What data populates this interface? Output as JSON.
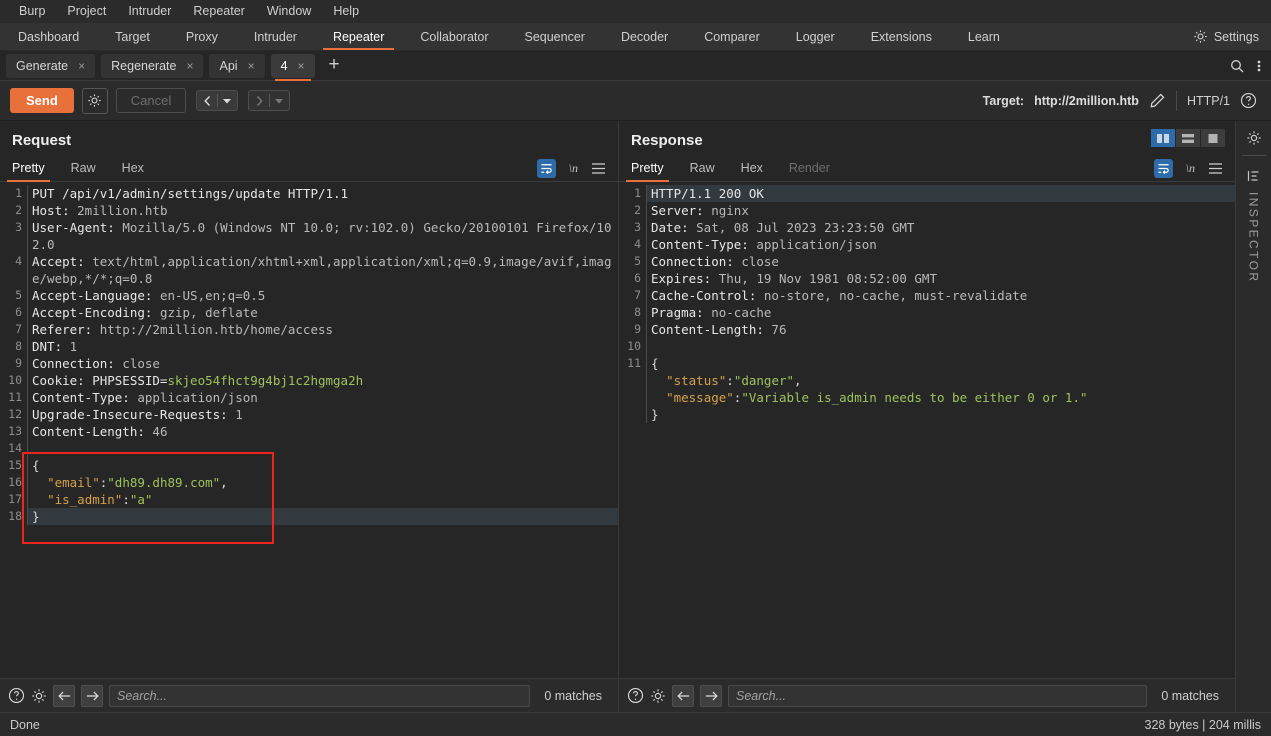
{
  "menubar": {
    "items": [
      "Burp",
      "Project",
      "Intruder",
      "Repeater",
      "Window",
      "Help"
    ]
  },
  "main_tabs": {
    "items": [
      "Dashboard",
      "Target",
      "Proxy",
      "Intruder",
      "Repeater",
      "Collaborator",
      "Sequencer",
      "Decoder",
      "Comparer",
      "Logger",
      "Extensions",
      "Learn"
    ],
    "active": "Repeater",
    "settings_label": "Settings",
    "settings_icon": "gear-icon"
  },
  "repeater_tabs": {
    "items": [
      {
        "label": "Generate",
        "close": "×"
      },
      {
        "label": "Regenerate",
        "close": "×"
      },
      {
        "label": "Api",
        "close": "×"
      },
      {
        "label": "4",
        "close": "×"
      }
    ],
    "active_index": 3,
    "new_tab": "+",
    "search_icon": "search-icon",
    "menu_icon": "kebab-menu-icon"
  },
  "action_bar": {
    "send_label": "Send",
    "send_color": "#e8703a",
    "settings_icon": "gear-icon",
    "cancel_label": "Cancel",
    "prev_icon": "chevron-left-icon",
    "next_icon": "chevron-right-icon",
    "dropdown_icon": "caret-down-icon",
    "target_label": "Target:",
    "target_url": "http://2million.htb",
    "edit_icon": "pencil-icon",
    "http_version": "HTTP/1",
    "help_icon": "question-circle-icon"
  },
  "request": {
    "title": "Request",
    "view_tabs": [
      "Pretty",
      "Raw",
      "Hex"
    ],
    "active_view": "Pretty",
    "pretty_icon": "word-wrap-icon",
    "newline_icon": "newline-icon",
    "menu_icon": "hamburger-menu-icon",
    "lines": [
      {
        "n": "1",
        "segments": [
          {
            "t": "PUT /api/v1/admin/settings/update HTTP/1.1",
            "c": "hdr-name"
          }
        ]
      },
      {
        "n": "2",
        "segments": [
          {
            "t": "Host: ",
            "c": "hdr-name"
          },
          {
            "t": "2million.htb",
            "c": "hdr-val"
          }
        ]
      },
      {
        "n": "3",
        "segments": [
          {
            "t": "User-Agent: ",
            "c": "hdr-name"
          },
          {
            "t": "Mozilla/5.0 (Windows NT 10.0; rv:102.0) Gecko/20100101 Firefox/102.0",
            "c": "hdr-val"
          }
        ]
      },
      {
        "n": "4",
        "segments": [
          {
            "t": "Accept: ",
            "c": "hdr-name"
          },
          {
            "t": "text/html,application/xhtml+xml,application/xml;q=0.9,image/avif,image/webp,*/*;q=0.8",
            "c": "hdr-val"
          }
        ]
      },
      {
        "n": "5",
        "segments": [
          {
            "t": "Accept-Language: ",
            "c": "hdr-name"
          },
          {
            "t": "en-US,en;q=0.5",
            "c": "hdr-val"
          }
        ]
      },
      {
        "n": "6",
        "segments": [
          {
            "t": "Accept-Encoding: ",
            "c": "hdr-name"
          },
          {
            "t": "gzip, deflate",
            "c": "hdr-val"
          }
        ]
      },
      {
        "n": "7",
        "segments": [
          {
            "t": "Referer: ",
            "c": "hdr-name"
          },
          {
            "t": "http://2million.htb/home/access",
            "c": "hdr-val"
          }
        ]
      },
      {
        "n": "8",
        "segments": [
          {
            "t": "DNT: ",
            "c": "hdr-name"
          },
          {
            "t": "1",
            "c": "hdr-val"
          }
        ]
      },
      {
        "n": "9",
        "segments": [
          {
            "t": "Connection: ",
            "c": "hdr-name"
          },
          {
            "t": "close",
            "c": "hdr-val"
          }
        ]
      },
      {
        "n": "10",
        "segments": [
          {
            "t": "Cookie: PHPSESSID=",
            "c": "hdr-name"
          },
          {
            "t": "skjeo54fhct9g4bj1c2hgmga2h",
            "c": "cookie-val"
          }
        ]
      },
      {
        "n": "11",
        "segments": [
          {
            "t": "Content-Type: ",
            "c": "hdr-name"
          },
          {
            "t": "application/json",
            "c": "hdr-val"
          }
        ]
      },
      {
        "n": "12",
        "segments": [
          {
            "t": "Upgrade-Insecure-Requests: ",
            "c": "hdr-name"
          },
          {
            "t": "1",
            "c": "hdr-val"
          }
        ]
      },
      {
        "n": "13",
        "segments": [
          {
            "t": "Content-Length: ",
            "c": "hdr-name"
          },
          {
            "t": "46",
            "c": "hdr-val"
          }
        ]
      },
      {
        "n": "14",
        "segments": []
      },
      {
        "n": "15",
        "segments": [
          {
            "t": "{",
            "c": "j-punc"
          }
        ]
      },
      {
        "n": "16",
        "segments": [
          {
            "t": "  \"email\"",
            "c": "j-key"
          },
          {
            "t": ":",
            "c": "j-punc"
          },
          {
            "t": "\"dh89.dh89.com\"",
            "c": "j-str"
          },
          {
            "t": ",",
            "c": "j-punc"
          }
        ]
      },
      {
        "n": "17",
        "segments": [
          {
            "t": "  \"is_admin\"",
            "c": "j-key"
          },
          {
            "t": ":",
            "c": "j-punc"
          },
          {
            "t": "\"a\"",
            "c": "j-str"
          }
        ]
      },
      {
        "n": "18",
        "segments": [
          {
            "t": "}",
            "c": "j-punc"
          }
        ],
        "highlight": true
      }
    ],
    "annotation": {
      "color": "#f1241b",
      "shape": "rectangle",
      "covers": "json-body"
    },
    "search_placeholder": "Search...",
    "matches_label": "0 matches",
    "help_icon": "question-circle-icon",
    "settings_icon": "gear-icon",
    "back_icon": "arrow-left-icon",
    "forward_icon": "arrow-right-icon"
  },
  "response": {
    "title": "Response",
    "view_tabs": [
      "Pretty",
      "Raw",
      "Hex",
      "Render"
    ],
    "active_view": "Pretty",
    "disabled_view": "Render",
    "layout_toggles": [
      "split-vertical-icon",
      "split-horizontal-icon",
      "single-pane-icon"
    ],
    "layout_selected": 0,
    "pretty_icon": "word-wrap-icon",
    "newline_icon": "newline-icon",
    "menu_icon": "hamburger-menu-icon",
    "lines": [
      {
        "n": "1",
        "segments": [
          {
            "t": "HTTP/1.1 200 OK",
            "c": "hdr-name"
          }
        ],
        "highlight": true
      },
      {
        "n": "2",
        "segments": [
          {
            "t": "Server: ",
            "c": "hdr-name"
          },
          {
            "t": "nginx",
            "c": "hdr-val"
          }
        ]
      },
      {
        "n": "3",
        "segments": [
          {
            "t": "Date: ",
            "c": "hdr-name"
          },
          {
            "t": "Sat, 08 Jul 2023 23:23:50 GMT",
            "c": "hdr-val"
          }
        ]
      },
      {
        "n": "4",
        "segments": [
          {
            "t": "Content-Type: ",
            "c": "hdr-name"
          },
          {
            "t": "application/json",
            "c": "hdr-val"
          }
        ]
      },
      {
        "n": "5",
        "segments": [
          {
            "t": "Connection: ",
            "c": "hdr-name"
          },
          {
            "t": "close",
            "c": "hdr-val"
          }
        ]
      },
      {
        "n": "6",
        "segments": [
          {
            "t": "Expires: ",
            "c": "hdr-name"
          },
          {
            "t": "Thu, 19 Nov 1981 08:52:00 GMT",
            "c": "hdr-val"
          }
        ]
      },
      {
        "n": "7",
        "segments": [
          {
            "t": "Cache-Control: ",
            "c": "hdr-name"
          },
          {
            "t": "no-store, no-cache, must-revalidate",
            "c": "hdr-val"
          }
        ]
      },
      {
        "n": "8",
        "segments": [
          {
            "t": "Pragma: ",
            "c": "hdr-name"
          },
          {
            "t": "no-cache",
            "c": "hdr-val"
          }
        ]
      },
      {
        "n": "9",
        "segments": [
          {
            "t": "Content-Length: ",
            "c": "hdr-name"
          },
          {
            "t": "76",
            "c": "hdr-val"
          }
        ]
      },
      {
        "n": "10",
        "segments": []
      },
      {
        "n": "11",
        "segments": [
          {
            "t": "{",
            "c": "j-punc"
          }
        ]
      },
      {
        "n": "",
        "segments": [
          {
            "t": "  \"status\"",
            "c": "j-key"
          },
          {
            "t": ":",
            "c": "j-punc"
          },
          {
            "t": "\"danger\"",
            "c": "j-str"
          },
          {
            "t": ",",
            "c": "j-punc"
          }
        ]
      },
      {
        "n": "",
        "segments": [
          {
            "t": "  \"message\"",
            "c": "j-key"
          },
          {
            "t": ":",
            "c": "j-punc"
          },
          {
            "t": "\"Variable is_admin needs to be either 0 or 1.\"",
            "c": "j-str"
          }
        ]
      },
      {
        "n": "",
        "segments": [
          {
            "t": "}",
            "c": "j-punc"
          }
        ]
      }
    ],
    "search_placeholder": "Search...",
    "matches_label": "0 matches",
    "help_icon": "question-circle-icon",
    "settings_icon": "gear-icon",
    "back_icon": "arrow-left-icon",
    "forward_icon": "arrow-right-icon"
  },
  "inspector": {
    "label": "INSPECTOR",
    "gear_icon": "gear-icon",
    "panel_icon": "panel-icon"
  },
  "status_bar": {
    "left": "Done",
    "right": "328 bytes | 204 millis"
  }
}
